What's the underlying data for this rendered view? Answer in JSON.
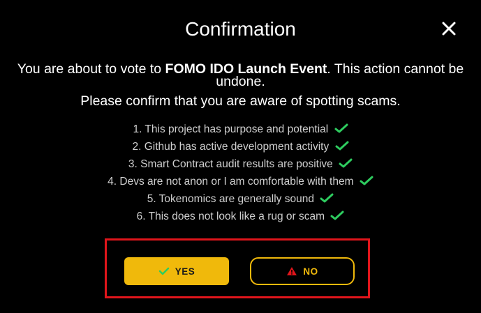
{
  "dialog": {
    "title": "Confirmation",
    "message_prefix": "You are about to vote to ",
    "event_name": "FOMO IDO Launch Event",
    "message_suffix": ". This action cannot be undone.",
    "message_line2": "Please confirm that you are aware of spotting scams.",
    "checklist": [
      "1. This project has purpose and potential",
      "2. Github has active development activity",
      "3. Smart Contract audit results are positive",
      "4. Devs are not anon or I am comfortable with them",
      "5. Tokenomics are generally sound",
      "6. This does not look like a rug or scam"
    ],
    "yes_label": "YES",
    "no_label": "NO"
  },
  "icons": {
    "close": "close-icon",
    "check": "check-icon",
    "yes": "check-icon",
    "no": "warning-icon"
  },
  "colors": {
    "background": "#000000",
    "accent": "#f0b90b",
    "check": "#2ecc5f",
    "warning": "#e0151b",
    "highlight": "#e0151b"
  }
}
